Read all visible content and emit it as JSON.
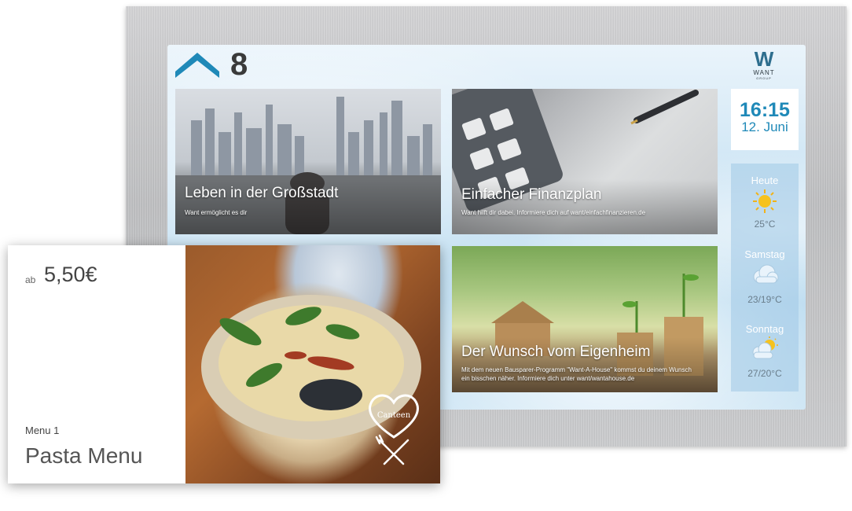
{
  "display": {
    "page_number": "8",
    "logo": {
      "mark": "W",
      "name": "WANT",
      "sub": "GROUP"
    },
    "tiles": [
      {
        "title": "Leben in der Großstadt",
        "subtitle": "Want ermöglicht es dir"
      },
      {
        "title": "Einfacher Finanzplan",
        "subtitle": "Want hilft dir dabei. Informiere dich auf want/einfachfinanzieren.de"
      },
      {
        "title": "Der Wunsch vom Eigenheim",
        "subtitle": "Mit dem neuen Bausparer-Programm \"Want-A-House\" kommst du deinem Wunsch ein bisschen näher. Informiere dich unter want/wantahouse.de"
      }
    ],
    "clock": {
      "time": "16:15",
      "date": "12. Juni"
    },
    "weather": [
      {
        "day": "Heute",
        "temp": "25°C",
        "icon": "sun-icon"
      },
      {
        "day": "Samstag",
        "temp": "23/19°C",
        "icon": "cloud-icon"
      },
      {
        "day": "Sonntag",
        "temp": "27/20°C",
        "icon": "sun-cloud-icon"
      }
    ]
  },
  "menu_card": {
    "price_prefix": "ab",
    "price": "5,50€",
    "label": "Menu 1",
    "name": "Pasta Menu",
    "logo_text": "Canteen"
  },
  "colors": {
    "accent": "#1f89b8",
    "chevron": "#1f89b8"
  }
}
